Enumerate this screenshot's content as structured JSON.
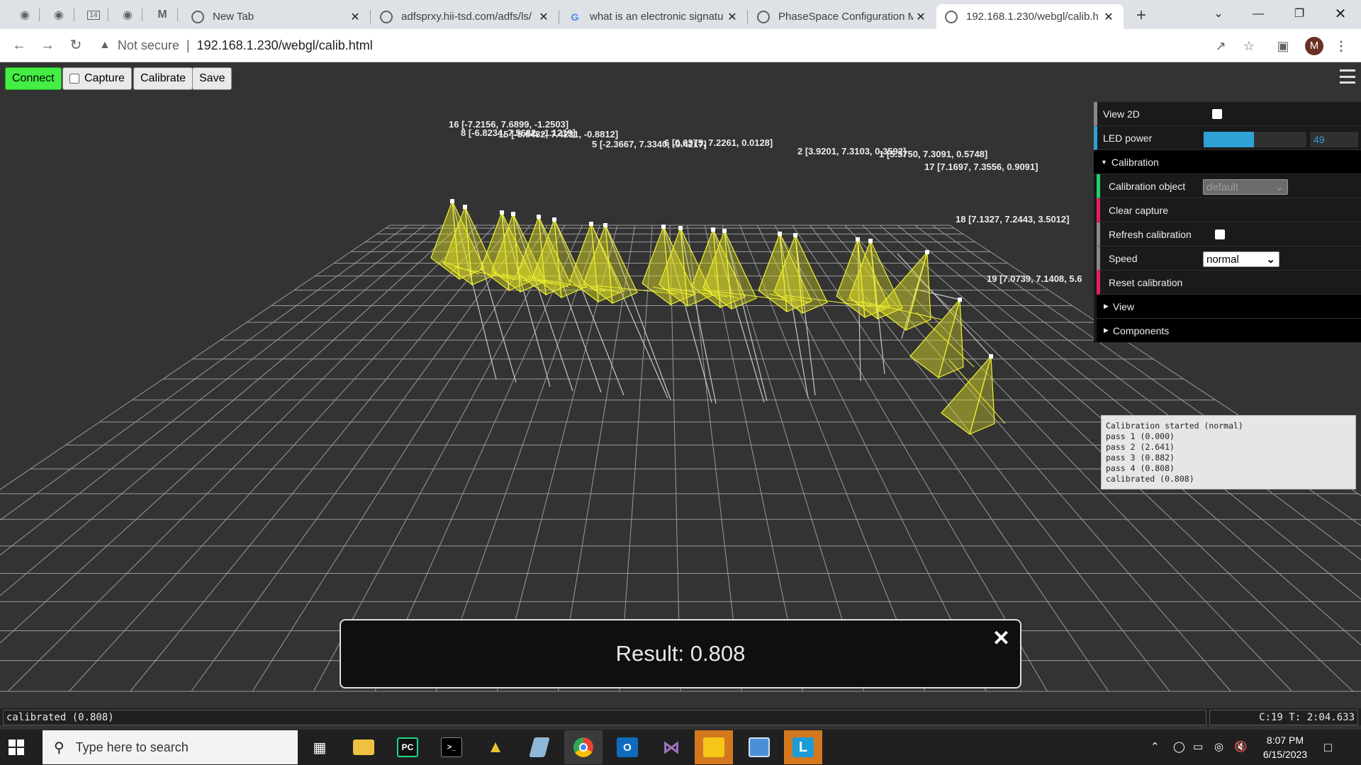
{
  "browser": {
    "tabs": [
      {
        "title": "New Tab",
        "icon": "chrome-icon"
      },
      {
        "title": "adfsprxy.hii-tsd.com/adfs/ls/",
        "icon": "globe-icon"
      },
      {
        "title": "what is an electronic signatu",
        "icon": "google-icon"
      },
      {
        "title": "PhaseSpace Configuration M",
        "icon": "globe-icon"
      },
      {
        "title": "192.168.1.230/webgl/calib.h",
        "icon": "globe-icon",
        "active": true
      }
    ],
    "pinned_badge": "14",
    "security_label": "Not secure",
    "url": "192.168.1.230/webgl/calib.html",
    "avatar_letter": "M"
  },
  "toolbar": {
    "connect_label": "Connect",
    "capture_label": "Capture",
    "calibrate_label": "Calibrate",
    "save_label": "Save"
  },
  "markers": [
    {
      "label": "16 [-7.2156, 7.6899, -1.2503]"
    },
    {
      "label": "8 [-6.8234, 7.5682, -1.1219]"
    },
    {
      "label": "15 [-5.6482, 7.4231, -0.8812]"
    },
    {
      "label": "5 [-2.3667, 7.3340, -0.4217]"
    },
    {
      "label": "6 [0.6375, 7.2261, 0.0128]"
    },
    {
      "label": "2 [3.9201, 7.3103, 0.3592]"
    },
    {
      "label": "1 [5.3750, 7.3091, 0.5748]"
    },
    {
      "label": "17 [7.1697, 7.3556, 0.9091]"
    },
    {
      "label": "18 [7.1327, 7.2443, 3.5012]"
    },
    {
      "label": "19 [7.0739, 7.1408, 5.6"
    }
  ],
  "gui": {
    "view2d_label": "View 2D",
    "view2d_checked": false,
    "led_power_label": "LED power",
    "led_power_value": "49",
    "led_power_fraction": 0.49,
    "calibration_folder": "Calibration",
    "calibration_object_label": "Calibration object",
    "calibration_object_value": "default",
    "clear_capture_label": "Clear capture",
    "refresh_calibration_label": "Refresh calibration",
    "speed_label": "Speed",
    "speed_value": "normal",
    "reset_calibration_label": "Reset calibration",
    "view_folder": "View",
    "components_folder": "Components",
    "accent_blue": "#2fa1d6",
    "accent_green": "#1ed36f",
    "accent_red": "#e61d5f"
  },
  "log": "Calibration started (normal)\npass 1 (0.000)\npass 2 (2.641)\npass 3 (0.882)\npass 4 (0.808)\ncalibrated (0.808)",
  "result": {
    "text": "Result: 0.808"
  },
  "status": {
    "left": "calibrated (0.808)",
    "right": "C:19 T: 2:04.633"
  },
  "taskbar": {
    "search_placeholder": "Type here to search",
    "time": "8:07 PM",
    "date": "6/15/2023"
  }
}
